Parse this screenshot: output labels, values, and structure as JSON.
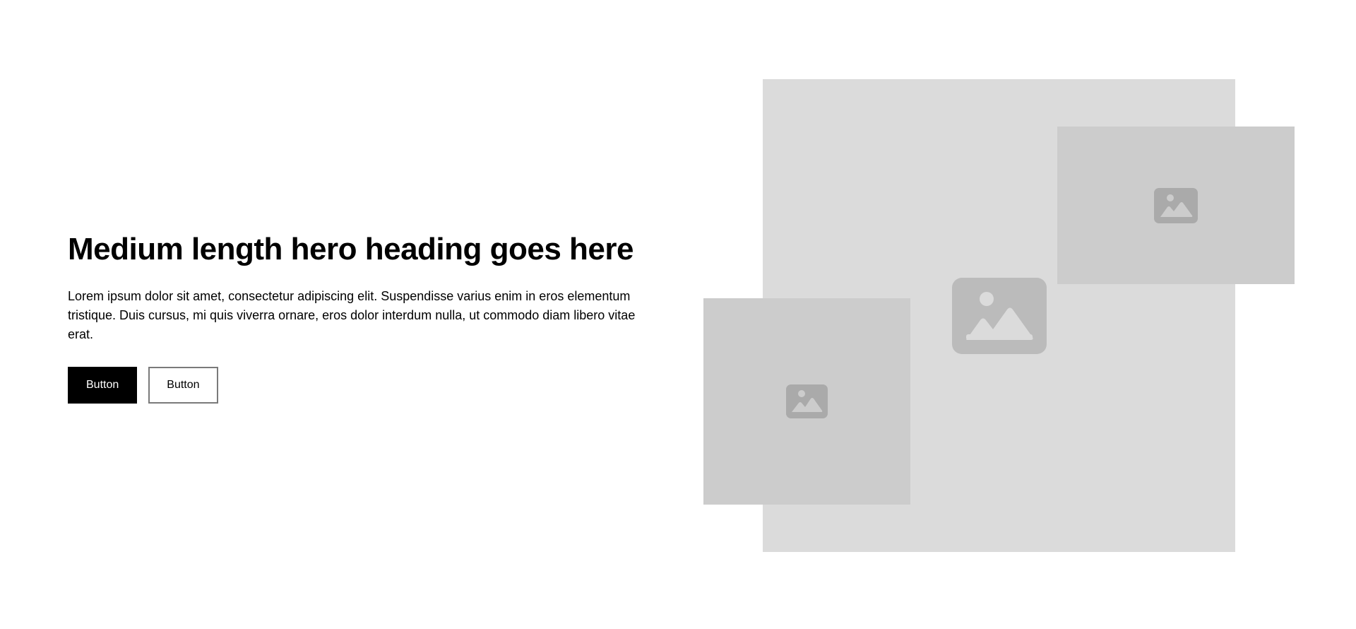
{
  "hero": {
    "heading": "Medium length hero heading goes here",
    "body": "Lorem ipsum dolor sit amet, consectetur adipiscing elit. Suspendisse varius enim in eros elementum tristique. Duis cursus, mi quis viverra ornare, eros dolor interdum nulla, ut commodo diam libero vitae erat.",
    "primary_button_label": "Button",
    "secondary_button_label": "Button"
  },
  "images": {
    "large": {
      "icon": "image-placeholder-icon"
    },
    "top_right": {
      "icon": "image-placeholder-icon"
    },
    "bottom_left": {
      "icon": "image-placeholder-icon"
    }
  },
  "colors": {
    "primary_button_bg": "#000000",
    "primary_button_text": "#ffffff",
    "secondary_button_border": "#7a7a7a",
    "large_image_bg": "#dbdbdb",
    "small_image_bg": "#cccccc",
    "placeholder_icon_large": "#bbbbbb",
    "placeholder_icon_small": "#aaaaaa"
  }
}
